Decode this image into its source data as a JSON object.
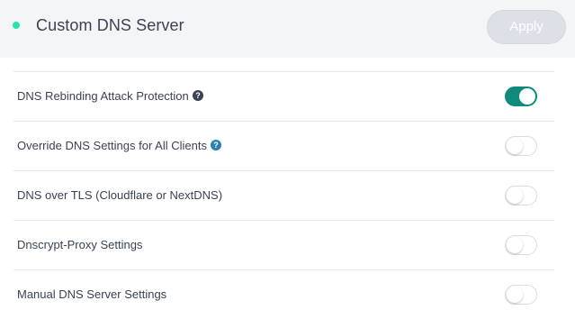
{
  "header": {
    "title": "Custom DNS Server",
    "apply_label": "Apply",
    "status_color": "#2ee0b0"
  },
  "settings": [
    {
      "label": "DNS Rebinding Attack Protection",
      "help_icon": "question-circle-icon",
      "enabled": true
    },
    {
      "label": "Override DNS Settings for All Clients",
      "help_icon": "question-circle-icon",
      "enabled": false
    },
    {
      "label": "DNS over TLS (Cloudflare or NextDNS)",
      "enabled": false
    },
    {
      "label": "Dnscrypt-Proxy Settings",
      "enabled": false
    },
    {
      "label": "Manual DNS Server Settings",
      "enabled": false
    }
  ],
  "colors": {
    "toggle_on": "#11897b",
    "toggle_off_border": "#d9dce1",
    "apply_disabled": "#dde0e6"
  }
}
